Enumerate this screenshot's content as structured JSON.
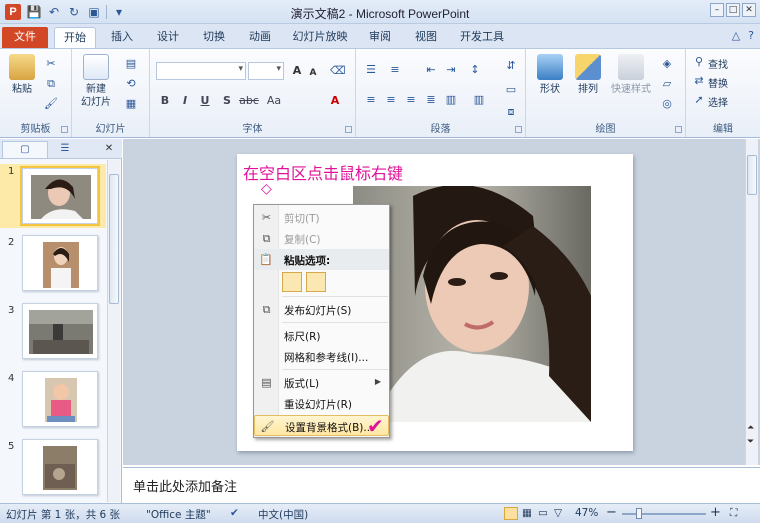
{
  "window": {
    "app_icon": "P",
    "title": "演示文稿2 - Microsoft PowerPoint",
    "controls": [
      "–",
      "□",
      "✕"
    ]
  },
  "tabs": {
    "file": "文件",
    "items": [
      "开始",
      "插入",
      "设计",
      "切换",
      "动画",
      "幻灯片放映",
      "审阅",
      "视图",
      "开发工具"
    ],
    "active": "开始"
  },
  "ribbon": {
    "clipboard": {
      "label": "剪贴板",
      "paste": "粘贴"
    },
    "slides": {
      "label": "幻灯片",
      "new_slide_1": "新建",
      "new_slide_2": "幻灯片"
    },
    "font": {
      "label": "字体",
      "bold": "B",
      "italic": "I",
      "underline": "U",
      "strike": "S",
      "spacing": "abc",
      "case": "Aa",
      "grow": "A",
      "shrink": "A"
    },
    "paragraph": {
      "label": "段落"
    },
    "drawing": {
      "label": "绘图",
      "shape": "形状",
      "arrange": "排列",
      "quick_style": "快速样式"
    },
    "editing": {
      "label": "编辑",
      "find": "查找",
      "replace": "替换",
      "select": "选择"
    }
  },
  "slides_panel": {
    "thumbnails": [
      {
        "number": "1",
        "selected": true
      },
      {
        "number": "2",
        "selected": false
      },
      {
        "number": "3",
        "selected": false
      },
      {
        "number": "4",
        "selected": false
      },
      {
        "number": "5",
        "selected": false
      }
    ],
    "close": "✕"
  },
  "slide": {
    "instruction": "在空白区点击鼠标右键",
    "marker": "◇"
  },
  "context_menu": {
    "cut": "剪切(T)",
    "copy": "复制(C)",
    "paste_options": "粘贴选项:",
    "publish": "发布幻灯片(S)",
    "ruler": "标尺(R)",
    "grid": "网格和参考线(I)...",
    "layout": "版式(L)",
    "reset": "重设幻灯片(R)",
    "format_background": "设置背景格式(B)..."
  },
  "check_mark": "✔",
  "notes": {
    "placeholder": "单击此处添加备注"
  },
  "status": {
    "slide_count": "幻灯片 第 1 张，共 6 张",
    "theme": "\"Office 主题\"",
    "language": "中文(中国)",
    "zoom": "47%",
    "zoom_minus": "−",
    "zoom_plus": "+"
  }
}
